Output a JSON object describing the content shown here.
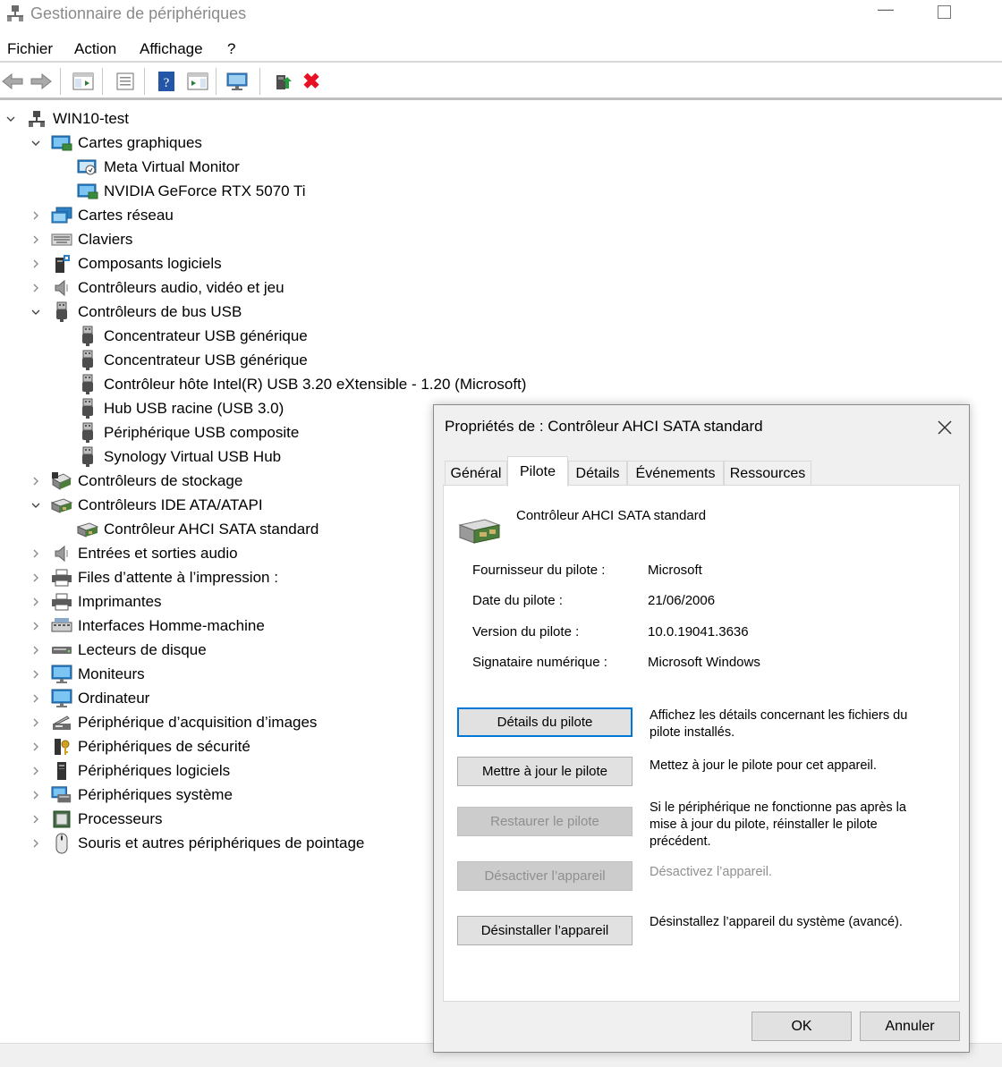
{
  "window": {
    "title": "Gestionnaire de périphériques",
    "minimize": "—"
  },
  "menu": [
    "Fichier",
    "Action",
    "Affichage",
    "?"
  ],
  "toolbar": {
    "buttons": [
      "back-arrow-icon",
      "forward-arrow-icon",
      "console-tree-icon",
      "properties-icon",
      "help-icon",
      "action-pane-icon",
      "scan-hardware-icon",
      "update-driver-icon",
      "uninstall-icon"
    ],
    "uninstall_glyph": "✖"
  },
  "tree": [
    {
      "label": "WIN10-test",
      "level": 0,
      "chevron": "down",
      "icon": "computer-network-icon"
    },
    {
      "label": "Cartes graphiques",
      "level": 1,
      "chevron": "down",
      "icon": "display-adapter-icon"
    },
    {
      "label": "Meta Virtual Monitor",
      "level": 2,
      "chevron": "none",
      "icon": "virtual-monitor-icon"
    },
    {
      "label": "NVIDIA GeForce RTX 5070 Ti",
      "level": 2,
      "chevron": "none",
      "icon": "display-adapter-icon"
    },
    {
      "label": "Cartes réseau",
      "level": 1,
      "chevron": "right",
      "icon": "network-adapter-icon"
    },
    {
      "label": "Claviers",
      "level": 1,
      "chevron": "right",
      "icon": "keyboard-icon"
    },
    {
      "label": "Composants logiciels",
      "level": 1,
      "chevron": "right",
      "icon": "software-component-icon"
    },
    {
      "label": "Contrôleurs audio, vidéo et jeu",
      "level": 1,
      "chevron": "right",
      "icon": "speaker-icon"
    },
    {
      "label": "Contrôleurs de bus USB",
      "level": 1,
      "chevron": "down",
      "icon": "usb-icon"
    },
    {
      "label": "Concentrateur USB générique",
      "level": 2,
      "chevron": "none",
      "icon": "usb-icon"
    },
    {
      "label": "Concentrateur USB générique",
      "level": 2,
      "chevron": "none",
      "icon": "usb-icon"
    },
    {
      "label": "Contrôleur hôte Intel(R) USB 3.20 eXtensible - 1.20 (Microsoft)",
      "level": 2,
      "chevron": "none",
      "icon": "usb-icon"
    },
    {
      "label": "Hub USB racine (USB 3.0)",
      "level": 2,
      "chevron": "none",
      "icon": "usb-icon"
    },
    {
      "label": "Périphérique USB composite",
      "level": 2,
      "chevron": "none",
      "icon": "usb-icon"
    },
    {
      "label": "Synology Virtual USB Hub",
      "level": 2,
      "chevron": "none",
      "icon": "usb-icon"
    },
    {
      "label": "Contrôleurs de stockage",
      "level": 1,
      "chevron": "right",
      "icon": "storage-controller-icon"
    },
    {
      "label": "Contrôleurs IDE ATA/ATAPI",
      "level": 1,
      "chevron": "down",
      "icon": "ide-controller-icon"
    },
    {
      "label": "Contrôleur AHCI SATA standard",
      "level": 2,
      "chevron": "none",
      "icon": "ide-controller-icon"
    },
    {
      "label": "Entrées et sorties audio",
      "level": 1,
      "chevron": "right",
      "icon": "speaker-icon"
    },
    {
      "label": "Files d’attente à l’impression :",
      "level": 1,
      "chevron": "right",
      "icon": "printer-icon"
    },
    {
      "label": "Imprimantes",
      "level": 1,
      "chevron": "right",
      "icon": "printer-icon"
    },
    {
      "label": "Interfaces Homme-machine",
      "level": 1,
      "chevron": "right",
      "icon": "hid-icon"
    },
    {
      "label": "Lecteurs de disque",
      "level": 1,
      "chevron": "right",
      "icon": "disk-drive-icon"
    },
    {
      "label": "Moniteurs",
      "level": 1,
      "chevron": "right",
      "icon": "monitor-icon"
    },
    {
      "label": "Ordinateur",
      "level": 1,
      "chevron": "right",
      "icon": "monitor-icon"
    },
    {
      "label": "Périphérique d’acquisition d’images",
      "level": 1,
      "chevron": "right",
      "icon": "camera-icon"
    },
    {
      "label": "Périphériques de sécurité",
      "level": 1,
      "chevron": "right",
      "icon": "security-key-icon"
    },
    {
      "label": "Périphériques logiciels",
      "level": 1,
      "chevron": "right",
      "icon": "software-device-icon"
    },
    {
      "label": "Périphériques système",
      "level": 1,
      "chevron": "right",
      "icon": "system-device-icon"
    },
    {
      "label": "Processeurs",
      "level": 1,
      "chevron": "right",
      "icon": "processor-icon"
    },
    {
      "label": "Souris et autres périphériques de pointage",
      "level": 1,
      "chevron": "right",
      "icon": "mouse-icon"
    }
  ],
  "dialog": {
    "title": "Propriétés de : Contrôleur AHCI SATA standard",
    "close_glyph": "✕",
    "tabs": [
      "Général",
      "Pilote",
      "Détails",
      "Événements",
      "Ressources"
    ],
    "active_tab": "Pilote",
    "device_name": "Contrôleur AHCI SATA standard",
    "properties": [
      {
        "label": "Fournisseur du pilote :",
        "value": "Microsoft"
      },
      {
        "label": "Date du pilote :",
        "value": "21/06/2006"
      },
      {
        "label": "Version du pilote :",
        "value": "10.0.19041.3636"
      },
      {
        "label": "Signataire numérique :",
        "value": "Microsoft Windows"
      }
    ],
    "actions": [
      {
        "label": "Détails du pilote",
        "description": "Affichez les détails concernant les fichiers du pilote installés.",
        "enabled": true,
        "focused": true
      },
      {
        "label": "Mettre à jour le pilote",
        "description": "Mettez à jour le pilote pour cet appareil.",
        "enabled": true,
        "focused": false
      },
      {
        "label": "Restaurer le pilote",
        "description": "Si le périphérique ne fonctionne pas après la mise à jour du pilote, réinstaller le pilote précédent.",
        "enabled": false,
        "focused": false
      },
      {
        "label": "Désactiver l’appareil",
        "description": "Désactivez l’appareil.",
        "enabled": false,
        "focused": false
      },
      {
        "label": "Désinstaller l’appareil",
        "description": "Désinstallez l’appareil du système (avancé).",
        "enabled": true,
        "focused": false
      }
    ],
    "ok_label": "OK",
    "cancel_label": "Annuler"
  },
  "colors": {
    "accent": "#0078d7",
    "disabled_text": "#8f8f8f",
    "delete_red": "#e81123"
  }
}
